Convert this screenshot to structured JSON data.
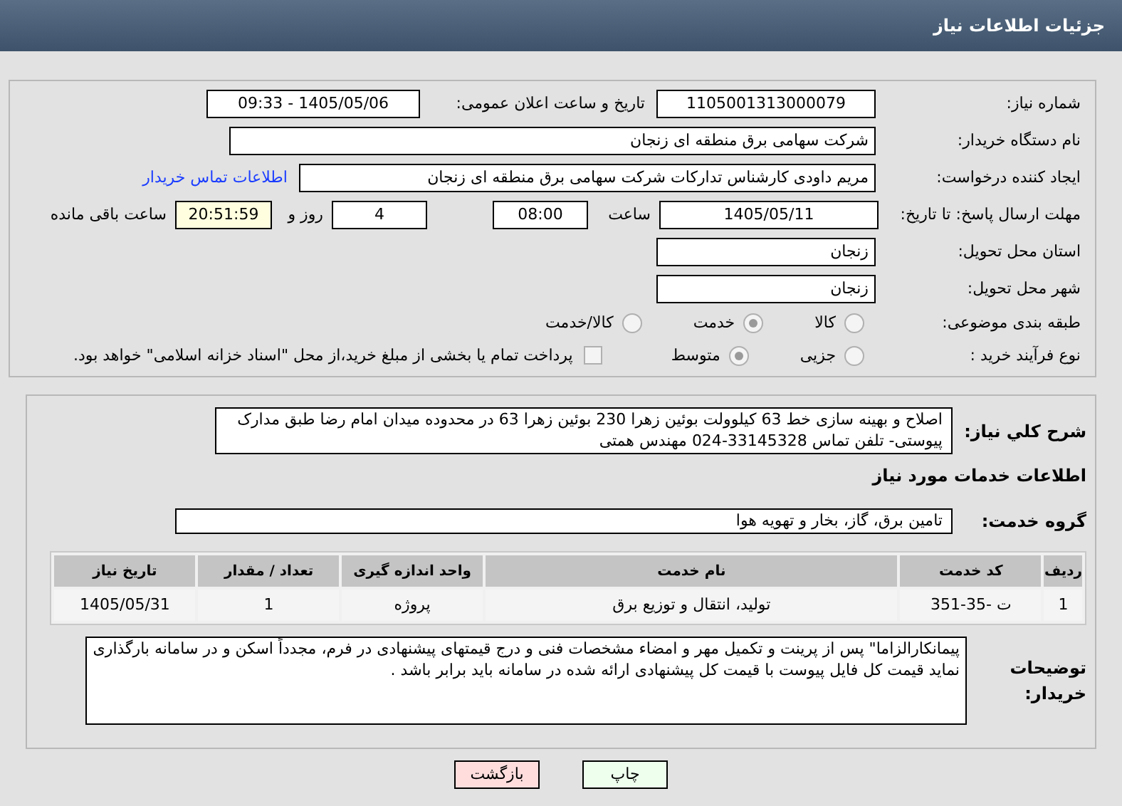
{
  "header": {
    "title": "جزئیات اطلاعات نیاز"
  },
  "need_number": {
    "label": "شماره نیاز:",
    "value": "1105001313000079"
  },
  "announce": {
    "label": "تاریخ و ساعت اعلان عمومی:",
    "value": "1405/05/06 - 09:33"
  },
  "buyer": {
    "label": "نام دستگاه خریدار:",
    "value": "شرکت سهامی برق منطقه ای زنجان"
  },
  "creator": {
    "label": "ایجاد کننده درخواست:",
    "value": "مریم داودی کارشناس تدارکات شرکت سهامی برق منطقه ای زنجان",
    "link": "اطلاعات تماس خریدار"
  },
  "deadline": {
    "label": "مهلت ارسال پاسخ: تا تاریخ:",
    "date": "1405/05/11",
    "time_label": "ساعت",
    "time": "08:00",
    "days": "4",
    "days_label": "روز و",
    "remaining": "20:51:59",
    "remaining_label": "ساعت باقی مانده"
  },
  "province": {
    "label": "استان محل تحویل:",
    "value": "زنجان"
  },
  "city": {
    "label": "شهر محل تحویل:",
    "value": "زنجان"
  },
  "category": {
    "label": "طبقه بندی موضوعی:",
    "options": [
      {
        "label": "کالا",
        "selected": false
      },
      {
        "label": "خدمت",
        "selected": true
      },
      {
        "label": "کالا/خدمت",
        "selected": false
      }
    ]
  },
  "purchase_type": {
    "label": "نوع فرآیند خرید :",
    "options": [
      {
        "label": "جزیی",
        "selected": false
      },
      {
        "label": "متوسط",
        "selected": true
      }
    ],
    "payment": {
      "checked": false,
      "text": "پرداخت تمام یا بخشی از مبلغ خرید،از محل \"اسناد خزانه اسلامی\" خواهد بود."
    }
  },
  "description": {
    "label": "شرح کلي نياز:",
    "value": "اصلاح و بهینه سازی خط 63 کیلوولت بوئین زهرا 230 بوئین زهرا 63 در محدوده میدان امام رضا طبق مدارک پیوستی- تلفن تماس 33145328-024 مهندس همتی"
  },
  "services_title": "اطلاعات خدمات مورد نیاز",
  "service_group": {
    "label": "گروه خدمت:",
    "value": "تامین برق، گاز، بخار و تهویه هوا"
  },
  "table": {
    "columns": [
      "ردیف",
      "کد خدمت",
      "نام خدمت",
      "واحد اندازه گیری",
      "تعداد / مقدار",
      "تاریخ نیاز"
    ],
    "rows": [
      [
        "1",
        "ت -35-351",
        "تولید، انتقال و توزیع برق",
        "پروژه",
        "1",
        "1405/05/31"
      ]
    ]
  },
  "buyer_notes": {
    "label": "توضیحات خریدار:",
    "value": "پیمانکارالزاما\" پس از پرینت و تکمیل مهر و امضاء مشخصات فنی و درج قیمتهای پیشنهادی در فرم، مجدداً اسکن و در سامانه بارگذاری نماید قیمت کل فایل پیوست با قیمت کل پیشنهادی ارائه شده در سامانه باید برابر باشد ."
  },
  "buttons": [
    {
      "label": "چاپ",
      "kind": "print"
    },
    {
      "label": "بازگشت",
      "kind": "back"
    }
  ]
}
